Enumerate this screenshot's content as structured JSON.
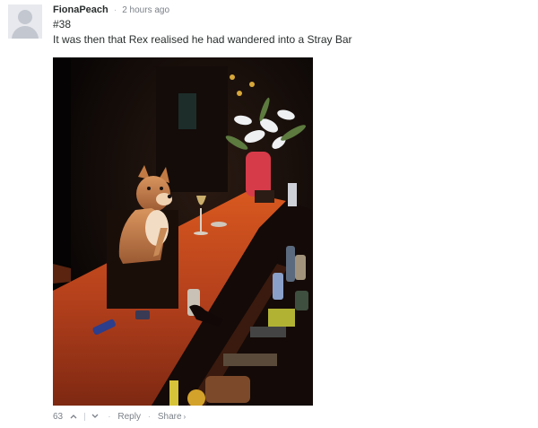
{
  "comment": {
    "author": "FionaPeach",
    "separator": "·",
    "timestamp": "2 hours ago",
    "text_lines": [
      "#38",
      "It was then that Rex realised he had wandered into a Stray Bar"
    ],
    "votes": {
      "count": "63",
      "upvote_icon": "chevron-up-icon",
      "downvote_icon": "chevron-down-icon"
    },
    "actions": {
      "reply": "Reply",
      "share": "Share",
      "share_chevron": "›",
      "dot": "·"
    }
  },
  "colors": {
    "text": "#2a2e2e",
    "muted": "#7b8188",
    "bar_wood": "#b4401c"
  }
}
